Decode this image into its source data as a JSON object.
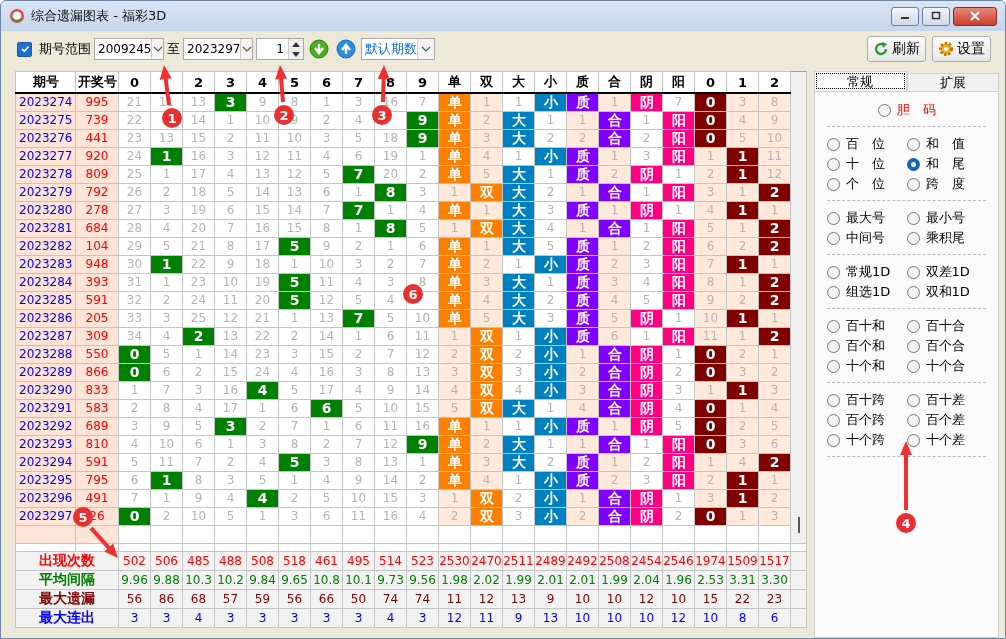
{
  "window": {
    "title": "综合遗漏图表 - 福彩3D"
  },
  "toolbar": {
    "range_checkbox": {
      "label": "期号范围",
      "checked": true
    },
    "from": "2009245",
    "to_label": "至",
    "to": "2023297",
    "count": "1",
    "period_mode": "默认期数",
    "buttons": [
      "刷新",
      "设置"
    ]
  },
  "table": {
    "headers": [
      "期号",
      "开奖号"
    ],
    "columns": [
      {
        "label": "0",
        "kind": "digit"
      },
      {
        "kind": "digit"
      },
      {
        "label": "2",
        "kind": "digit"
      },
      {
        "label": "3",
        "kind": "digit"
      },
      {
        "label": "4",
        "kind": "digit"
      },
      {
        "label": "5",
        "kind": "digit"
      },
      {
        "label": "6",
        "kind": "digit"
      },
      {
        "label": "7",
        "kind": "digit"
      },
      {
        "label": "8",
        "kind": "digit"
      },
      {
        "label": "9",
        "kind": "digit"
      },
      {
        "label": "单",
        "kind": "parity"
      },
      {
        "label": "双",
        "kind": "parity"
      },
      {
        "label": "大",
        "kind": "size"
      },
      {
        "label": "小",
        "kind": "size"
      },
      {
        "label": "质",
        "kind": "prime"
      },
      {
        "label": "合",
        "kind": "prime"
      },
      {
        "label": "阴",
        "kind": "yinyang"
      },
      {
        "label": "阳",
        "kind": "yinyang"
      },
      {
        "label": "0",
        "kind": "remainder"
      },
      {
        "label": "1",
        "kind": "remainder"
      },
      {
        "label": "2",
        "kind": "remainder"
      }
    ],
    "rows": [
      {
        "period": "2023274",
        "number": "995",
        "cells": [
          "21",
          "11",
          "13",
          "3",
          "9",
          "8",
          "1",
          "3",
          "16",
          "7",
          "单",
          "1",
          "1",
          "小",
          "质",
          "1",
          "阴",
          "7",
          "0",
          "3",
          "8"
        ],
        "hits": [
          false,
          false,
          false,
          true,
          false,
          false,
          false,
          false,
          false,
          false,
          true,
          false,
          false,
          true,
          true,
          false,
          true,
          false,
          true,
          false,
          false
        ]
      },
      {
        "period": "2023275",
        "number": "739",
        "cells": [
          "22",
          null,
          "14",
          "1",
          "10",
          "9",
          "2",
          "4",
          null,
          "9",
          "单",
          "2",
          "大",
          "1",
          "1",
          "合",
          "1",
          "阳",
          "0",
          "4",
          "9"
        ],
        "hits": [
          false,
          false,
          false,
          false,
          false,
          false,
          false,
          false,
          false,
          true,
          true,
          false,
          true,
          false,
          false,
          true,
          false,
          true,
          true,
          false,
          false
        ]
      },
      {
        "period": "2023276",
        "number": "441",
        "cells": [
          "23",
          "13",
          "15",
          "2",
          "11",
          "10",
          "3",
          "5",
          "18",
          "9",
          "单",
          "3",
          "大",
          "2",
          "2",
          "合",
          "2",
          "阳",
          "0",
          "5",
          "10"
        ],
        "hits": [
          false,
          false,
          false,
          false,
          false,
          false,
          false,
          false,
          false,
          true,
          true,
          false,
          true,
          false,
          false,
          true,
          false,
          true,
          true,
          false,
          false
        ]
      },
      {
        "period": "2023277",
        "number": "920",
        "cells": [
          "24",
          "1",
          "16",
          "3",
          "12",
          "11",
          "4",
          "6",
          "19",
          "1",
          "单",
          "4",
          "1",
          "小",
          "质",
          "1",
          "3",
          "阳",
          "1",
          "1",
          "11"
        ],
        "hits": [
          false,
          true,
          false,
          false,
          false,
          false,
          false,
          false,
          false,
          false,
          true,
          false,
          false,
          true,
          true,
          false,
          false,
          true,
          false,
          true,
          false
        ]
      },
      {
        "period": "2023278",
        "number": "809",
        "cells": [
          "25",
          "1",
          "17",
          "4",
          "13",
          "12",
          "5",
          "7",
          "20",
          "2",
          "单",
          "5",
          "大",
          "1",
          "质",
          "2",
          "阴",
          "1",
          "2",
          "1",
          "12"
        ],
        "hits": [
          false,
          false,
          false,
          false,
          false,
          false,
          false,
          true,
          false,
          false,
          true,
          false,
          true,
          false,
          true,
          false,
          true,
          false,
          false,
          true,
          false
        ]
      },
      {
        "period": "2023279",
        "number": "792",
        "cells": [
          "26",
          "2",
          "18",
          "5",
          "14",
          "13",
          "6",
          "1",
          "8",
          "3",
          "1",
          "双",
          "大",
          "2",
          "1",
          "合",
          "1",
          "阳",
          "3",
          "1",
          "2"
        ],
        "hits": [
          false,
          false,
          false,
          false,
          false,
          false,
          false,
          false,
          true,
          false,
          false,
          true,
          true,
          false,
          false,
          true,
          false,
          true,
          false,
          false,
          true
        ]
      },
      {
        "period": "2023280",
        "number": "278",
        "cells": [
          "27",
          "3",
          "19",
          "6",
          "15",
          "14",
          "7",
          "7",
          "1",
          "4",
          "单",
          "1",
          "大",
          "3",
          "质",
          "1",
          "阴",
          "1",
          "4",
          "1",
          "1"
        ],
        "hits": [
          false,
          false,
          false,
          false,
          false,
          false,
          false,
          true,
          false,
          false,
          true,
          false,
          true,
          false,
          true,
          false,
          true,
          false,
          false,
          true,
          false
        ]
      },
      {
        "period": "2023281",
        "number": "684",
        "cells": [
          "28",
          "4",
          "20",
          "7",
          "16",
          "15",
          "8",
          "1",
          "8",
          "5",
          "1",
          "双",
          "大",
          "4",
          "1",
          "合",
          "1",
          "阳",
          "5",
          "1",
          "2"
        ],
        "hits": [
          false,
          false,
          false,
          false,
          false,
          false,
          false,
          false,
          true,
          false,
          false,
          true,
          true,
          false,
          false,
          true,
          false,
          true,
          false,
          false,
          true
        ]
      },
      {
        "period": "2023282",
        "number": "104",
        "cells": [
          "29",
          "5",
          "21",
          "8",
          "17",
          "5",
          "9",
          "2",
          "1",
          "6",
          "单",
          "1",
          "大",
          "5",
          "质",
          "1",
          "2",
          "阳",
          "6",
          "2",
          "2"
        ],
        "hits": [
          false,
          false,
          false,
          false,
          false,
          true,
          false,
          false,
          false,
          false,
          true,
          false,
          true,
          false,
          true,
          false,
          false,
          true,
          false,
          false,
          true
        ]
      },
      {
        "period": "2023283",
        "number": "948",
        "cells": [
          "30",
          "1",
          "22",
          "9",
          "18",
          "1",
          "10",
          "3",
          "2",
          "7",
          "单",
          "2",
          "1",
          "小",
          "质",
          "2",
          "3",
          "阳",
          "7",
          "1",
          "1"
        ],
        "hits": [
          false,
          true,
          false,
          false,
          false,
          false,
          false,
          false,
          false,
          false,
          true,
          false,
          false,
          true,
          true,
          false,
          false,
          true,
          false,
          true,
          false
        ]
      },
      {
        "period": "2023284",
        "number": "393",
        "cells": [
          "31",
          "1",
          "23",
          "10",
          "19",
          "5",
          "11",
          "4",
          "3",
          "8",
          "单",
          "3",
          "大",
          "1",
          "质",
          "3",
          "4",
          "阳",
          "8",
          "1",
          "2"
        ],
        "hits": [
          false,
          false,
          false,
          false,
          false,
          true,
          false,
          false,
          false,
          false,
          true,
          false,
          true,
          false,
          true,
          false,
          false,
          true,
          false,
          false,
          true
        ]
      },
      {
        "period": "2023285",
        "number": "591",
        "cells": [
          "32",
          "2",
          "24",
          "11",
          "20",
          "5",
          "12",
          "5",
          "4",
          null,
          "单",
          "4",
          "大",
          "2",
          "质",
          "4",
          "5",
          "阳",
          "9",
          "2",
          "2"
        ],
        "hits": [
          false,
          false,
          false,
          false,
          false,
          true,
          false,
          false,
          false,
          false,
          true,
          false,
          true,
          false,
          true,
          false,
          false,
          true,
          false,
          false,
          true
        ]
      },
      {
        "period": "2023286",
        "number": "205",
        "cells": [
          "33",
          "3",
          "25",
          "12",
          "21",
          "1",
          "13",
          "7",
          "5",
          "10",
          "单",
          "5",
          "大",
          "3",
          "质",
          "5",
          "阴",
          "1",
          "10",
          "1",
          "1"
        ],
        "hits": [
          false,
          false,
          false,
          false,
          false,
          false,
          false,
          true,
          false,
          false,
          true,
          false,
          true,
          false,
          true,
          false,
          true,
          false,
          false,
          true,
          false
        ]
      },
      {
        "period": "2023287",
        "number": "309",
        "cells": [
          "34",
          "4",
          "2",
          "13",
          "22",
          "2",
          "14",
          "1",
          "6",
          "11",
          "1",
          "双",
          "1",
          "小",
          "质",
          "6",
          "1",
          "阳",
          "11",
          "1",
          "2"
        ],
        "hits": [
          false,
          false,
          true,
          false,
          false,
          false,
          false,
          false,
          false,
          false,
          false,
          true,
          false,
          true,
          true,
          false,
          false,
          true,
          false,
          false,
          true
        ]
      },
      {
        "period": "2023288",
        "number": "550",
        "cells": [
          "0",
          "5",
          "1",
          "14",
          "23",
          "3",
          "15",
          "2",
          "7",
          "12",
          "2",
          "双",
          "2",
          "小",
          "1",
          "合",
          "阴",
          "1",
          "0",
          "2",
          "1"
        ],
        "hits": [
          true,
          false,
          false,
          false,
          false,
          false,
          false,
          false,
          false,
          false,
          false,
          true,
          false,
          true,
          false,
          true,
          true,
          false,
          true,
          false,
          false
        ]
      },
      {
        "period": "2023289",
        "number": "866",
        "cells": [
          "0",
          "6",
          "2",
          "15",
          "24",
          "4",
          "16",
          "3",
          "8",
          "13",
          "3",
          "双",
          "3",
          "小",
          "2",
          "合",
          "阴",
          "2",
          "0",
          "3",
          "2"
        ],
        "hits": [
          true,
          false,
          false,
          false,
          false,
          false,
          false,
          false,
          false,
          false,
          false,
          true,
          false,
          true,
          false,
          true,
          true,
          false,
          true,
          false,
          false
        ]
      },
      {
        "period": "2023290",
        "number": "833",
        "cells": [
          "1",
          "7",
          "3",
          "16",
          "4",
          "5",
          "17",
          "4",
          "9",
          "14",
          "4",
          "双",
          "4",
          "小",
          "3",
          "合",
          "阴",
          "3",
          "1",
          "1",
          "3"
        ],
        "hits": [
          false,
          false,
          false,
          false,
          true,
          false,
          false,
          false,
          false,
          false,
          false,
          true,
          false,
          true,
          false,
          true,
          true,
          false,
          false,
          true,
          false
        ]
      },
      {
        "period": "2023291",
        "number": "583",
        "cells": [
          "2",
          "8",
          "4",
          "17",
          "1",
          "6",
          "6",
          "5",
          "10",
          "15",
          "5",
          "双",
          "大",
          "1",
          "4",
          "合",
          "阴",
          "4",
          "0",
          "1",
          "4"
        ],
        "hits": [
          false,
          false,
          false,
          false,
          false,
          false,
          true,
          false,
          false,
          false,
          false,
          true,
          true,
          false,
          false,
          true,
          true,
          false,
          true,
          false,
          false
        ]
      },
      {
        "period": "2023292",
        "number": "689",
        "cells": [
          "3",
          "9",
          "5",
          "3",
          "2",
          "7",
          "1",
          "6",
          "11",
          "16",
          "单",
          "1",
          "1",
          "小",
          "质",
          "1",
          "阴",
          "5",
          "0",
          "2",
          "5"
        ],
        "hits": [
          false,
          false,
          false,
          true,
          false,
          false,
          false,
          false,
          false,
          false,
          true,
          false,
          false,
          true,
          true,
          false,
          true,
          false,
          true,
          false,
          false
        ]
      },
      {
        "period": "2023293",
        "number": "810",
        "cells": [
          "4",
          "10",
          "6",
          "1",
          "3",
          "8",
          "2",
          "7",
          "12",
          "9",
          "单",
          "2",
          "大",
          "1",
          "1",
          "合",
          "1",
          "阳",
          "0",
          "3",
          "6"
        ],
        "hits": [
          false,
          false,
          false,
          false,
          false,
          false,
          false,
          false,
          false,
          true,
          true,
          false,
          true,
          false,
          false,
          true,
          false,
          true,
          true,
          false,
          false
        ]
      },
      {
        "period": "2023294",
        "number": "591",
        "cells": [
          "5",
          "11",
          "7",
          "2",
          "4",
          "5",
          "3",
          "8",
          "13",
          "1",
          "单",
          "3",
          "大",
          "2",
          "质",
          "1",
          "2",
          "阳",
          "1",
          "4",
          "2"
        ],
        "hits": [
          false,
          false,
          false,
          false,
          false,
          true,
          false,
          false,
          false,
          false,
          true,
          false,
          true,
          false,
          true,
          false,
          false,
          true,
          false,
          false,
          true
        ]
      },
      {
        "period": "2023295",
        "number": "795",
        "cells": [
          "6",
          "1",
          "8",
          "3",
          "5",
          "1",
          "4",
          "9",
          "14",
          "2",
          "单",
          "4",
          "1",
          "小",
          "质",
          "2",
          "3",
          "阳",
          "2",
          "1",
          "1"
        ],
        "hits": [
          false,
          true,
          false,
          false,
          false,
          false,
          false,
          false,
          false,
          false,
          true,
          false,
          false,
          true,
          true,
          false,
          false,
          true,
          false,
          true,
          false
        ]
      },
      {
        "period": "2023296",
        "number": "491",
        "cells": [
          "7",
          "1",
          "9",
          "4",
          "4",
          "2",
          "5",
          "10",
          "15",
          "3",
          "1",
          "双",
          "2",
          "小",
          "1",
          "合",
          "阴",
          "1",
          "3",
          "1",
          "2"
        ],
        "hits": [
          false,
          false,
          false,
          false,
          true,
          false,
          false,
          false,
          false,
          false,
          false,
          true,
          false,
          true,
          false,
          true,
          true,
          false,
          false,
          true,
          false
        ]
      },
      {
        "period": "2023297",
        "number": "26",
        "cells": [
          "0",
          "2",
          "10",
          "5",
          "1",
          "3",
          "6",
          "11",
          "16",
          "4",
          "2",
          "双",
          "3",
          "小",
          "2",
          "合",
          "阴",
          "2",
          "0",
          "1",
          "3"
        ],
        "hits": [
          true,
          false,
          false,
          false,
          false,
          false,
          false,
          false,
          false,
          false,
          false,
          true,
          false,
          true,
          false,
          true,
          true,
          false,
          true,
          false,
          false
        ]
      }
    ],
    "stats": [
      {
        "label": "出现次数",
        "color": "#ff0000",
        "values": [
          "502",
          "506",
          "485",
          "488",
          "508",
          "518",
          "461",
          "495",
          "514",
          "523",
          "2530",
          "2470",
          "2511",
          "2489",
          "2492",
          "2508",
          "2454",
          "2546",
          "1974",
          "1509",
          "1517"
        ]
      },
      {
        "label": "平均间隔",
        "color": "#008000",
        "values": [
          "9.96",
          "9.88",
          "10.3",
          "10.2",
          "9.84",
          "9.65",
          "10.8",
          "10.1",
          "9.73",
          "9.56",
          "1.98",
          "2.02",
          "1.99",
          "2.01",
          "2.01",
          "1.99",
          "2.04",
          "1.96",
          "2.53",
          "3.31",
          "3.30"
        ]
      },
      {
        "label": "最大遗漏",
        "color": "#800000",
        "values": [
          "56",
          "86",
          "68",
          "57",
          "59",
          "56",
          "66",
          "50",
          "74",
          "74",
          "11",
          "12",
          "13",
          "9",
          "10",
          "10",
          "12",
          "10",
          "15",
          "22",
          "23"
        ]
      },
      {
        "label": "最大连出",
        "color": "#0000ff",
        "values": [
          "3",
          "3",
          "4",
          "3",
          "3",
          "3",
          "3",
          "3",
          "4",
          "3",
          "12",
          "11",
          "9",
          "13",
          "10",
          "10",
          "10",
          "12",
          "10",
          "8",
          "6"
        ]
      }
    ]
  },
  "side_panel": {
    "tabs": [
      {
        "label": "常规",
        "selected": true
      },
      {
        "label": "扩展",
        "selected": false
      }
    ],
    "groups": [
      [
        {
          "label": "胆　码",
          "selected": false,
          "kind": "accent"
        }
      ],
      [
        {
          "label": "百　位",
          "selected": false,
          "kind": "plain"
        },
        {
          "label": "和　值",
          "selected": false,
          "kind": "plain"
        },
        {
          "label": "十　位",
          "selected": false,
          "kind": "plain"
        },
        {
          "label": "和　尾",
          "selected": true,
          "kind": "plain"
        },
        {
          "label": "个　位",
          "selected": false,
          "kind": "plain"
        },
        {
          "label": "跨　度",
          "selected": false,
          "kind": "plain"
        }
      ],
      [
        {
          "label": "最大号",
          "selected": false,
          "kind": "plain"
        },
        {
          "label": "最小号",
          "selected": false,
          "kind": "plain"
        },
        {
          "label": "中间号",
          "selected": false,
          "kind": "plain"
        },
        {
          "label": "乘积尾",
          "selected": false,
          "kind": "plain"
        }
      ],
      [
        {
          "label": "常规1D",
          "selected": false,
          "kind": "plain"
        },
        {
          "label": "双差1D",
          "selected": false,
          "kind": "plain"
        },
        {
          "label": "组选1D",
          "selected": false,
          "kind": "plain"
        },
        {
          "label": "双和1D",
          "selected": false,
          "kind": "plain"
        }
      ],
      [
        {
          "label": "百十和",
          "selected": false,
          "kind": "plain"
        },
        {
          "label": "百十合",
          "selected": false,
          "kind": "plain"
        },
        {
          "label": "百个和",
          "selected": false,
          "kind": "plain"
        },
        {
          "label": "百个合",
          "selected": false,
          "kind": "plain"
        },
        {
          "label": "十个和",
          "selected": false,
          "kind": "plain"
        },
        {
          "label": "十个合",
          "selected": false,
          "kind": "plain"
        }
      ],
      [
        {
          "label": "百十跨",
          "selected": false,
          "kind": "plain"
        },
        {
          "label": "百十差",
          "selected": false,
          "kind": "plain"
        },
        {
          "label": "百个跨",
          "selected": false,
          "kind": "plain"
        },
        {
          "label": "百个差",
          "selected": false,
          "kind": "plain"
        },
        {
          "label": "十个跨",
          "selected": false,
          "kind": "plain"
        },
        {
          "label": "十个差",
          "selected": false,
          "kind": "plain"
        }
      ]
    ]
  },
  "callouts": [
    "1",
    "2",
    "3",
    "4",
    "5",
    "6"
  ]
}
